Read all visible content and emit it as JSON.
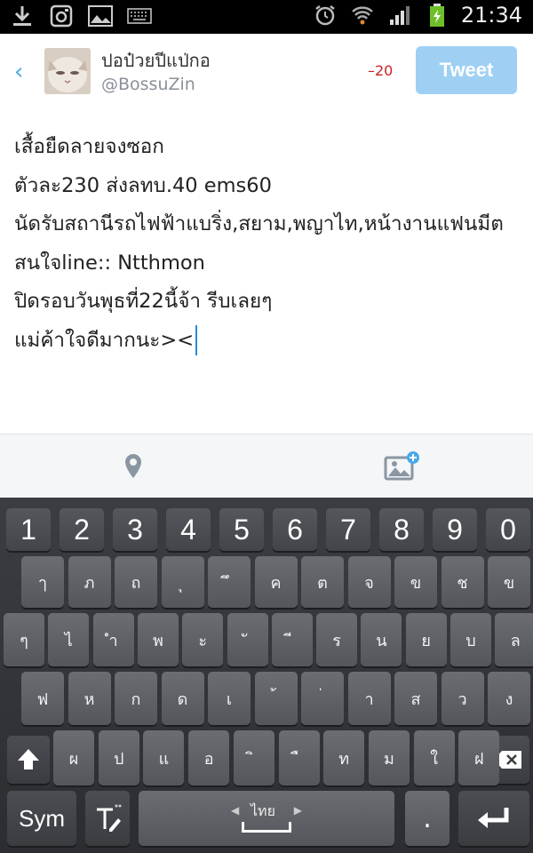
{
  "status_bar": {
    "time": "21:34"
  },
  "header": {
    "display_name": "ปอป๋วยปีแป่กอ",
    "handle": "@BossuZin",
    "char_count": "–20",
    "tweet_label": "Tweet"
  },
  "compose": {
    "lines": [
      "เสื้อยืดลายจงซอก",
      "ตัวละ230 ส่งลทบ.40 ems60",
      "นัดรับสถานีรถไฟฟ้าแบริ่ง,สยาม,พญาไท,หน้างานแฟนมีต",
      "สนใจline:: Ntthmon",
      "ปิดรอบวันพุธที่22นี้จ้า รีบเลยๆ",
      "แม่ค้าใจดีมากนะ><"
    ]
  },
  "keyboard": {
    "numbers": [
      "1",
      "2",
      "3",
      "4",
      "5",
      "6",
      "7",
      "8",
      "9",
      "0"
    ],
    "row1": [
      "ๅ",
      "ภ",
      "ถ",
      "ุ",
      "ึ",
      "ค",
      "ต",
      "จ",
      "ข",
      "ช",
      "ข"
    ],
    "row2": [
      "ๆ",
      "ไ",
      "ำ",
      "พ",
      "ะ",
      "ั",
      "ี",
      "ร",
      "น",
      "ย",
      "บ",
      "ล"
    ],
    "row3": [
      "ฟ",
      "ห",
      "ก",
      "ด",
      "เ",
      "้",
      "่",
      "า",
      "ส",
      "ว",
      "ง"
    ],
    "row4": [
      "ผ",
      "ป",
      "แ",
      "อ",
      "ิ",
      "ื",
      "ท",
      "ม",
      "ใ",
      "ฝ"
    ],
    "sym_label": "Sym",
    "space_label": "ไทย",
    "period": "."
  },
  "colors": {
    "accent": "#4aa8e8",
    "tweet_button": "#9fd0f4",
    "counter": "#cc2222"
  }
}
